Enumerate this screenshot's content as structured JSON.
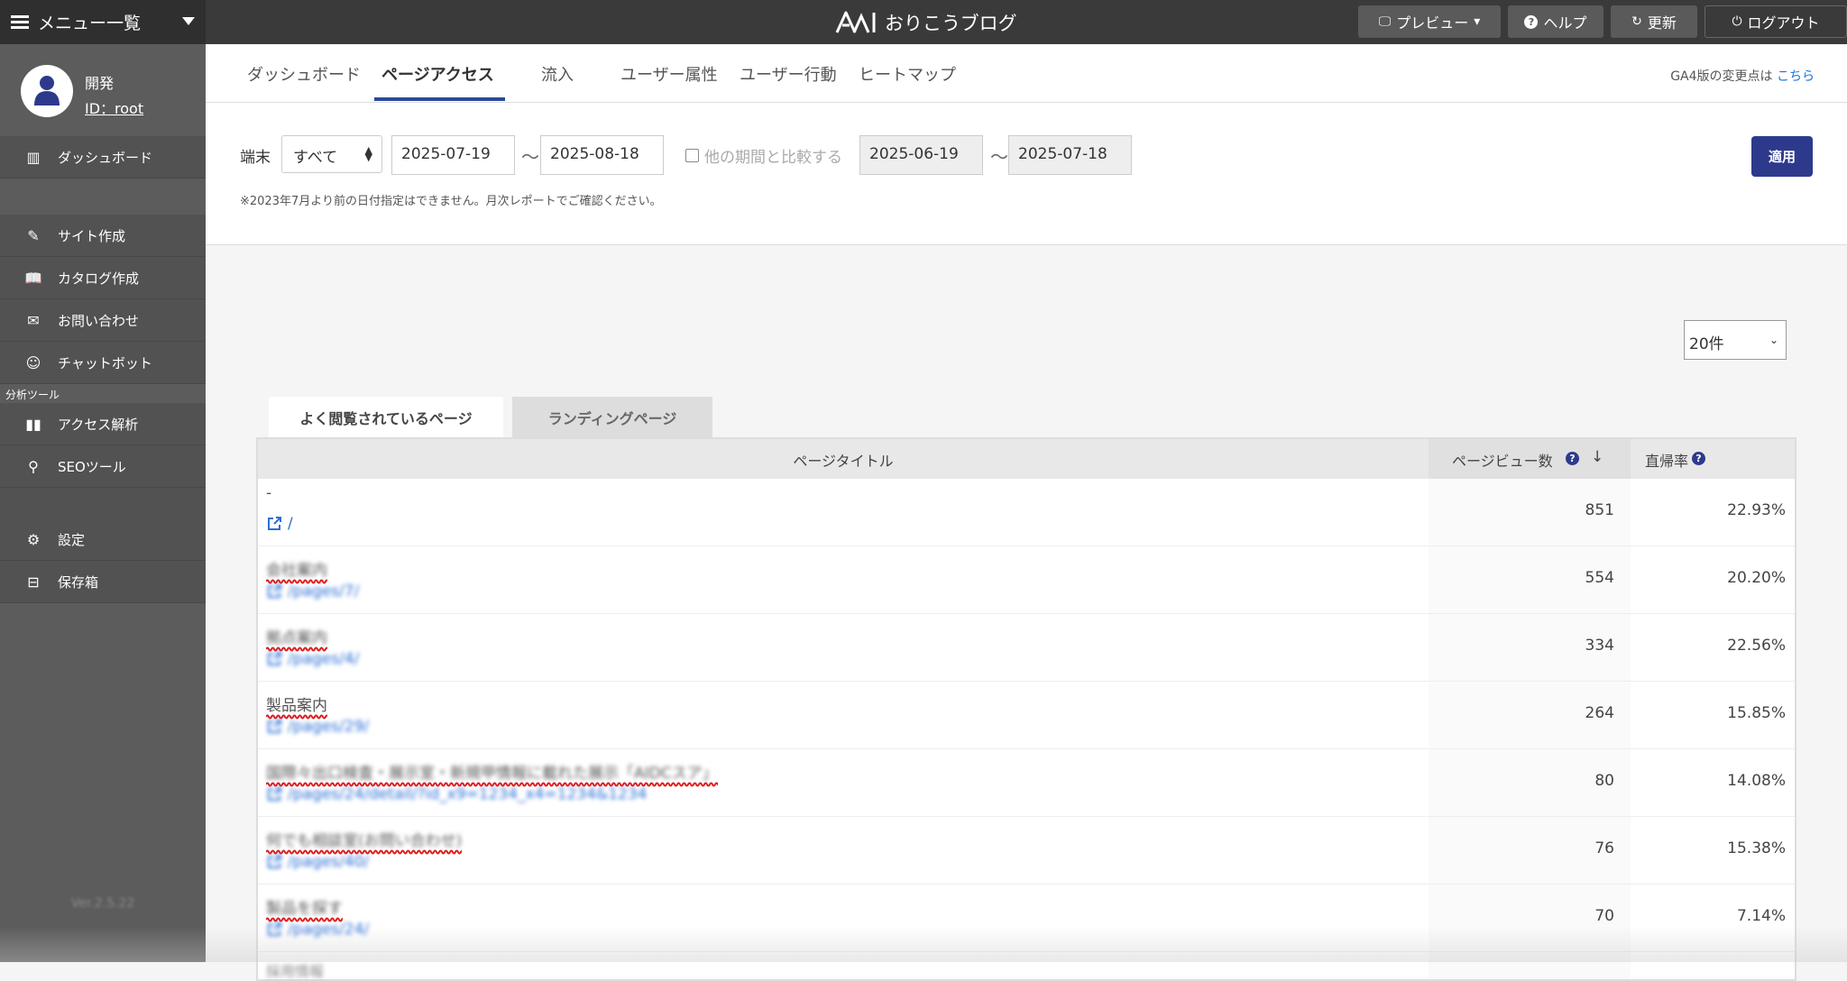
{
  "header": {
    "menu_label": "メニュー一覧",
    "brand": "おりこうブログ",
    "buttons": {
      "preview": "プレビュー",
      "help": "ヘルプ",
      "refresh": "更新",
      "logout": "ログアウト"
    }
  },
  "sidebar": {
    "user": {
      "name": "開発",
      "id": "ID：root"
    },
    "items": [
      {
        "label": "ダッシュボード",
        "icon": "chart-icon"
      },
      {
        "label": "サイト作成",
        "icon": "pencil-icon"
      },
      {
        "label": "カタログ作成",
        "icon": "book-icon"
      },
      {
        "label": "お問い合わせ",
        "icon": "envelope-icon"
      },
      {
        "label": "チャットボット",
        "icon": "robot-icon"
      },
      {
        "label": "アクセス解析",
        "icon": "bar-chart-icon"
      },
      {
        "label": "SEOツール",
        "icon": "search-icon"
      },
      {
        "label": "設定",
        "icon": "gear-icon"
      },
      {
        "label": "保存箱",
        "icon": "inbox-icon"
      }
    ],
    "section_label": "分析ツール",
    "version": "Ver.2.5.22"
  },
  "tabs": {
    "items": [
      "ダッシュボード",
      "ページアクセス",
      "流入",
      "ユーザー属性",
      "ユーザー行動",
      "ヒートマップ"
    ],
    "active": "ページアクセス",
    "ga4_note": "GA4版の変更点は",
    "ga4_link": "こちら"
  },
  "filter": {
    "device_label": "端末",
    "device_value": "すべて",
    "date_from": "2025-07-19",
    "date_to": "2025-08-18",
    "tilde": "～",
    "compare_label": "他の期間と比較する",
    "compare_checked": false,
    "compare_from": "2025-06-19",
    "compare_to": "2025-07-18",
    "note": "※2023年7月より前の日付指定はできません。月次レポートでご確認ください。",
    "apply": "適用"
  },
  "report": {
    "count_select": "20件",
    "tabs": [
      "よく閲覧されているページ",
      "ランディングページ"
    ],
    "active_tab": "よく閲覧されているページ",
    "columns": {
      "title": "ページタイトル",
      "pv": "ページビュー数",
      "bounce": "直帰率"
    },
    "sort": "pv-desc",
    "rows": [
      {
        "title": "-",
        "path": "/",
        "pv": "851",
        "bounce": "22.93%",
        "blurred": false
      },
      {
        "title": "会社案内",
        "path": "/pages/7/",
        "pv": "554",
        "bounce": "20.20%",
        "blurred": true
      },
      {
        "title": "拠点案内",
        "path": "/pages/4/",
        "pv": "334",
        "bounce": "22.56%",
        "blurred": true
      },
      {
        "title": "製品案内",
        "path": "/pages/29/",
        "pv": "264",
        "bounce": "15.85%",
        "blurred": true
      },
      {
        "title": "国際々出口検査・展示室・新規甲情報に載れた展示「AIDCスア」",
        "path": "/pages/24/detail/?id_x9=1234_x4=1234&1234",
        "pv": "80",
        "bounce": "14.08%",
        "blurred": true
      },
      {
        "title": "何でも相談室(お問い合わせ)",
        "path": "/pages/40/",
        "pv": "76",
        "bounce": "15.38%",
        "blurred": true
      },
      {
        "title": "製品を探す",
        "path": "/pages/24/",
        "pv": "70",
        "bounce": "7.14%",
        "blurred": true
      }
    ],
    "next_row_peek": "採用情報"
  },
  "colors": {
    "accent": "#2d3a8c",
    "link": "#2b6fd6",
    "topbar": "#3a3a3a",
    "sidebar": "#5c5c5c",
    "squiggle": "#e02020"
  }
}
